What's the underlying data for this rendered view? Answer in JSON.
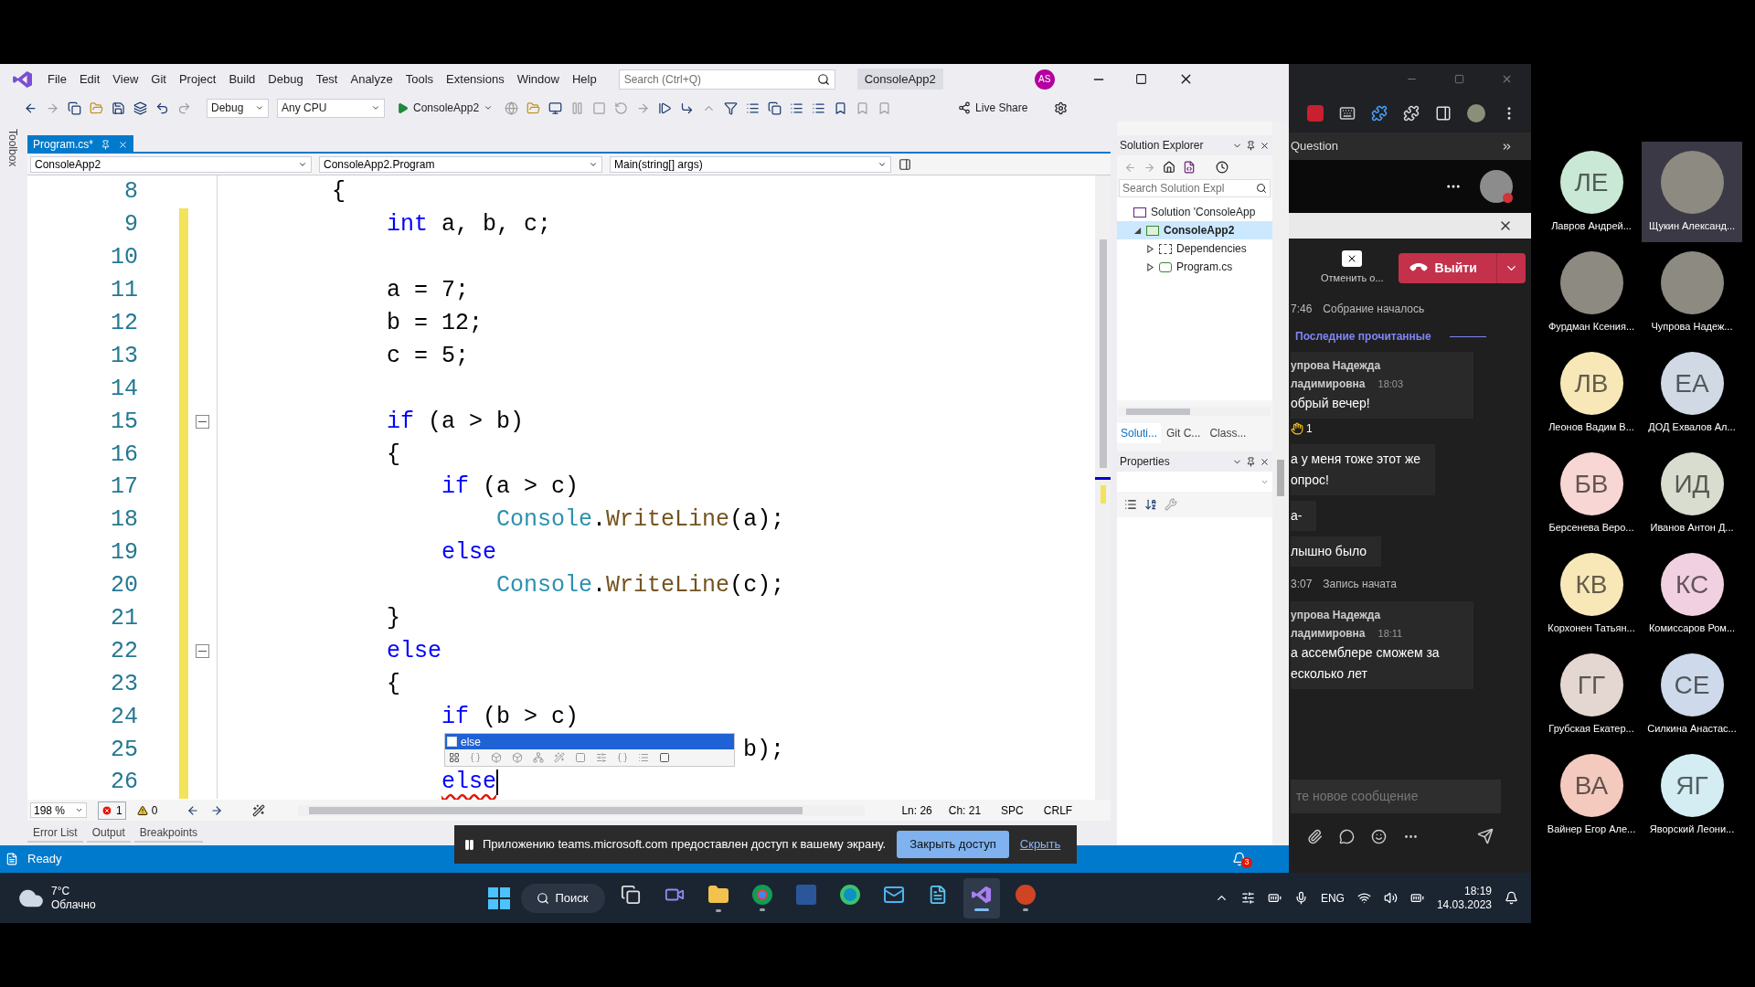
{
  "vs": {
    "menu": [
      "File",
      "Edit",
      "View",
      "Git",
      "Project",
      "Build",
      "Debug",
      "Test",
      "Analyze",
      "Tools",
      "Extensions",
      "Window",
      "Help"
    ],
    "search": {
      "placeholder": "Search (Ctrl+Q)"
    },
    "solution_name": "ConsoleApp2",
    "account": "AS",
    "toolbar": {
      "configuration": "Debug",
      "platform": "Any CPU",
      "start": "ConsoleApp2",
      "live_share": "Live Share"
    },
    "toolbox_label": "Toolbox",
    "tabs": [
      {
        "label": "Program.cs*",
        "selected": true
      }
    ],
    "nav": [
      "ConsoleApp2",
      "ConsoleApp2.Program",
      "Main(string[] args)"
    ],
    "lines": [
      {
        "number": "8",
        "changed": false,
        "foldable": false,
        "cursor": false,
        "error": false,
        "tokens": [
          {
            "text": "        {",
            "kind": "plain"
          }
        ]
      },
      {
        "number": "9",
        "changed": true,
        "foldable": false,
        "cursor": false,
        "error": false,
        "tokens": [
          {
            "text": "            int",
            "kind": "keyword"
          },
          {
            "text": " a, b, c;",
            "kind": "plain"
          }
        ]
      },
      {
        "number": "10",
        "changed": true,
        "foldable": false,
        "cursor": false,
        "error": false
      },
      {
        "number": "11",
        "changed": true,
        "foldable": false,
        "cursor": false,
        "error": false,
        "tokens": [
          {
            "text": "            a = 7;",
            "kind": "plain"
          }
        ]
      },
      {
        "number": "12",
        "changed": true,
        "foldable": false,
        "cursor": false,
        "error": false,
        "tokens": [
          {
            "text": "            b = 12;",
            "kind": "plain"
          }
        ]
      },
      {
        "number": "13",
        "changed": true,
        "foldable": false,
        "cursor": false,
        "error": false,
        "tokens": [
          {
            "text": "            c = 5;",
            "kind": "plain"
          }
        ]
      },
      {
        "number": "14",
        "changed": true,
        "foldable": false,
        "cursor": false,
        "error": false
      },
      {
        "number": "15",
        "changed": true,
        "foldable": true,
        "cursor": false,
        "error": false,
        "tokens": [
          {
            "text": "            if",
            "kind": "keyword"
          },
          {
            "text": " (a > b)",
            "kind": "plain"
          }
        ]
      },
      {
        "number": "16",
        "changed": true,
        "foldable": false,
        "cursor": false,
        "error": false,
        "tokens": [
          {
            "text": "            {",
            "kind": "plain"
          }
        ]
      },
      {
        "number": "17",
        "changed": true,
        "foldable": false,
        "cursor": false,
        "error": false,
        "tokens": [
          {
            "text": "                if",
            "kind": "keyword"
          },
          {
            "text": " (a > c)",
            "kind": "plain"
          }
        ]
      },
      {
        "number": "18",
        "changed": true,
        "foldable": false,
        "cursor": false,
        "error": false,
        "tokens": [
          {
            "text": "                    Console",
            "kind": "type"
          },
          {
            "text": ".",
            "kind": "plain"
          },
          {
            "text": "WriteLine",
            "kind": "method"
          },
          {
            "text": "(a);",
            "kind": "plain"
          }
        ]
      },
      {
        "number": "19",
        "changed": true,
        "foldable": false,
        "cursor": false,
        "error": false,
        "tokens": [
          {
            "text": "                else",
            "kind": "keyword"
          }
        ]
      },
      {
        "number": "20",
        "changed": true,
        "foldable": false,
        "cursor": false,
        "error": false,
        "tokens": [
          {
            "text": "                    Console",
            "kind": "type"
          },
          {
            "text": ".",
            "kind": "plain"
          },
          {
            "text": "WriteLine",
            "kind": "method"
          },
          {
            "text": "(c);",
            "kind": "plain"
          }
        ]
      },
      {
        "number": "21",
        "changed": true,
        "foldable": false,
        "cursor": false,
        "error": false,
        "tokens": [
          {
            "text": "            }",
            "kind": "plain"
          }
        ]
      },
      {
        "number": "22",
        "changed": true,
        "foldable": true,
        "cursor": false,
        "error": false,
        "tokens": [
          {
            "text": "            else",
            "kind": "keyword"
          }
        ]
      },
      {
        "number": "23",
        "changed": true,
        "foldable": false,
        "cursor": false,
        "error": false,
        "tokens": [
          {
            "text": "            {",
            "kind": "plain"
          }
        ]
      },
      {
        "number": "24",
        "changed": true,
        "foldable": false,
        "cursor": false,
        "error": false,
        "tokens": [
          {
            "text": "                if",
            "kind": "keyword"
          },
          {
            "text": " (b > c)",
            "kind": "plain"
          }
        ]
      },
      {
        "number": "25",
        "changed": true,
        "foldable": false,
        "cursor": false,
        "error": false,
        "tokens": [
          {
            "text": "                                      b);",
            "kind": "plain"
          }
        ]
      },
      {
        "number": "26",
        "changed": true,
        "foldable": false,
        "cursor": true,
        "error": true,
        "tokens": [
          {
            "text": "                else",
            "kind": "keyword"
          }
        ]
      }
    ],
    "completion": {
      "items": [
        {
          "label": "else",
          "selected": true
        }
      ]
    },
    "editor_status": {
      "zoom": "198 %",
      "errors": "1",
      "warnings": "0",
      "line": "Ln: 26",
      "column": "Ch: 21",
      "whitespace": "SPC",
      "line_endings": "CRLF"
    },
    "tool_tabs": [
      "Error List",
      "Output",
      "Breakpoints"
    ],
    "status": {
      "text": "Ready",
      "notifications": "3"
    },
    "solution_explorer": {
      "title": "Solution Explorer",
      "search_placeholder": "Search Solution Expl",
      "tree": [
        {
          "label": "Solution 'ConsoleApp",
          "kind": "solution",
          "selected": false,
          "children": [
            {
              "label": "ConsoleApp2",
              "kind": "project",
              "selected": true,
              "expanded": true,
              "children": [
                {
                  "label": "Dependencies",
                  "kind": "dependencies",
                  "selected": false,
                  "expanded": false
                },
                {
                  "label": "Program.cs",
                  "kind": "file",
                  "selected": false,
                  "expanded": false
                }
              ]
            }
          ]
        }
      ],
      "tabs": [
        {
          "label": "Soluti...",
          "selected": true
        },
        {
          "label": "Git C...",
          "selected": false
        },
        {
          "label": "Class...",
          "selected": false
        }
      ]
    },
    "properties": {
      "title": "Properties"
    }
  },
  "share_banner": {
    "text": "Приложению teams.microsoft.com предоставлен доступ к вашему экрану.",
    "button": "Закрыть доступ",
    "link": "Скрыть"
  },
  "chat": {
    "title": "Question",
    "cancel_label": "Отменить о...",
    "leave": "Выйти",
    "feed": [
      {
        "kind": "event",
        "time": "7:46",
        "text": "Собрание началось"
      },
      {
        "kind": "divider",
        "text": "Последние прочитанные"
      },
      {
        "kind": "message",
        "author": [
          "упрова Надежда",
          "ладимировна"
        ],
        "time": "18:03",
        "text": [
          "обрый вечер!"
        ],
        "reaction_count": "1"
      },
      {
        "kind": "bubble",
        "text": [
          "а у меня тоже этот же",
          "опрос!"
        ]
      },
      {
        "kind": "bubble",
        "text": [
          "а-"
        ]
      },
      {
        "kind": "bubble",
        "text": [
          "лышно было"
        ]
      },
      {
        "kind": "event",
        "time": "3:07",
        "text": "Запись начата"
      },
      {
        "kind": "message",
        "author": [
          "упрова Надежда",
          "ладимировна"
        ],
        "time": "18:11",
        "text": [
          "а ассемблере сможем за",
          "есколько лет"
        ]
      }
    ],
    "compose": {
      "placeholder": "те новое сообщение"
    }
  },
  "taskbar": {
    "weather": {
      "temperature": "7°C",
      "condition": "Облачно"
    },
    "search": "Поиск",
    "apps": [
      {
        "kind": "task-view",
        "running": false,
        "selected": false
      },
      {
        "kind": "chat",
        "running": false,
        "selected": false
      },
      {
        "kind": "folder",
        "running": true,
        "selected": false
      },
      {
        "kind": "browser",
        "running": true,
        "selected": false
      },
      {
        "kind": "word",
        "running": false,
        "selected": false
      },
      {
        "kind": "edge",
        "running": false,
        "selected": false
      },
      {
        "kind": "mail",
        "running": false,
        "selected": false
      },
      {
        "kind": "notes",
        "running": false,
        "selected": false
      },
      {
        "kind": "studio",
        "running": true,
        "selected": true
      },
      {
        "kind": "slides",
        "running": true,
        "selected": false
      }
    ],
    "language": "ENG",
    "time": "18:19",
    "date": "14.03.2023"
  },
  "participants": [
    {
      "name": "Лавров Андрей...",
      "kind": "initials",
      "initials": "ЛЕ",
      "color": "#c9e8d6",
      "speaking": false
    },
    {
      "name": "Щукин Александ...",
      "kind": "photo",
      "speaking": true
    },
    {
      "name": "Фурдман Ксения...",
      "kind": "photo",
      "speaking": false
    },
    {
      "name": "Чупрова Надеж...",
      "kind": "photo",
      "speaking": false
    },
    {
      "name": "Леонов Вадим В...",
      "kind": "initials",
      "initials": "ЛВ",
      "color": "#f8e8b8",
      "speaking": false
    },
    {
      "name": "ДОД Ехвалов Ал...",
      "kind": "initials",
      "initials": "ЕА",
      "color": "#d0d9e4",
      "speaking": false
    },
    {
      "name": "Берсенева Веро...",
      "kind": "initials",
      "initials": "БВ",
      "color": "#f8d6d3",
      "speaking": false
    },
    {
      "name": "Иванов Антон Д...",
      "kind": "initials",
      "initials": "ИД",
      "color": "#d8ddd0",
      "speaking": false
    },
    {
      "name": "Корхонен Татьян...",
      "kind": "initials",
      "initials": "КВ",
      "color": "#f8e8b8",
      "speaking": false
    },
    {
      "name": "Комиссаров Ром...",
      "kind": "initials",
      "initials": "КС",
      "color": "#f1d0e1",
      "speaking": false
    },
    {
      "name": "Грубская Екатер...",
      "kind": "initials",
      "initials": "ГГ",
      "color": "#e4d7d1",
      "speaking": false
    },
    {
      "name": "Силкина Анастас...",
      "kind": "initials",
      "initials": "СЕ",
      "color": "#cedaeb",
      "speaking": false
    },
    {
      "name": "Вайнер Егор Але...",
      "kind": "initials",
      "initials": "ВА",
      "color": "#f4cabe",
      "speaking": false
    },
    {
      "name": "Яворский Леони...",
      "kind": "initials",
      "initials": "ЯГ",
      "color": "#d3edf3",
      "speaking": false
    }
  ]
}
